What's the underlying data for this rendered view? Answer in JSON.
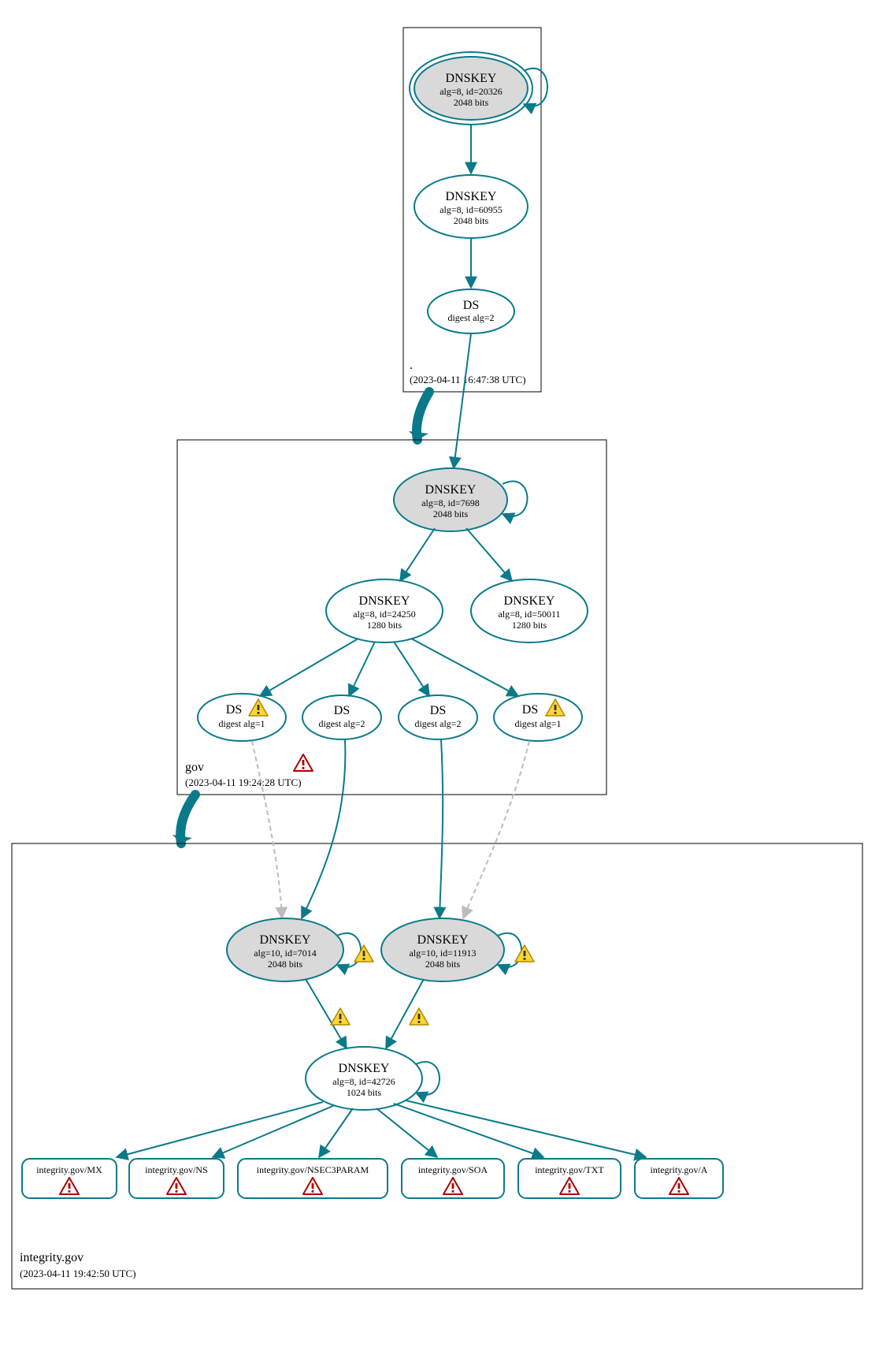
{
  "zones": {
    "root": {
      "name": ".",
      "ts": "(2023-04-11 16:47:38 UTC)"
    },
    "gov": {
      "name": "gov",
      "ts": "(2023-04-11 19:24:28 UTC)"
    },
    "integrity": {
      "name": "integrity.gov",
      "ts": "(2023-04-11 19:42:50 UTC)"
    }
  },
  "nodes": {
    "root_ksk": {
      "l1": "DNSKEY",
      "l2": "alg=8, id=20326",
      "l3": "2048 bits"
    },
    "root_zsk": {
      "l1": "DNSKEY",
      "l2": "alg=8, id=60955",
      "l3": "2048 bits"
    },
    "root_ds": {
      "l1": "DS",
      "l2": "digest alg=2"
    },
    "gov_ksk": {
      "l1": "DNSKEY",
      "l2": "alg=8, id=7698",
      "l3": "2048 bits"
    },
    "gov_zsk1": {
      "l1": "DNSKEY",
      "l2": "alg=8, id=24250",
      "l3": "1280 bits"
    },
    "gov_zsk2": {
      "l1": "DNSKEY",
      "l2": "alg=8, id=50011",
      "l3": "1280 bits"
    },
    "gov_ds1": {
      "l1": "DS",
      "l2": "digest alg=1"
    },
    "gov_ds2": {
      "l1": "DS",
      "l2": "digest alg=2"
    },
    "gov_ds3": {
      "l1": "DS",
      "l2": "digest alg=2"
    },
    "gov_ds4": {
      "l1": "DS",
      "l2": "digest alg=1"
    },
    "int_ksk1": {
      "l1": "DNSKEY",
      "l2": "alg=10, id=7014",
      "l3": "2048 bits"
    },
    "int_ksk2": {
      "l1": "DNSKEY",
      "l2": "alg=10, id=11913",
      "l3": "2048 bits"
    },
    "int_zsk": {
      "l1": "DNSKEY",
      "l2": "alg=8, id=42726",
      "l3": "1024 bits"
    }
  },
  "rr": {
    "mx": "integrity.gov/MX",
    "ns": "integrity.gov/NS",
    "nsec": "integrity.gov/NSEC3PARAM",
    "soa": "integrity.gov/SOA",
    "txt": "integrity.gov/TXT",
    "a": "integrity.gov/A"
  }
}
